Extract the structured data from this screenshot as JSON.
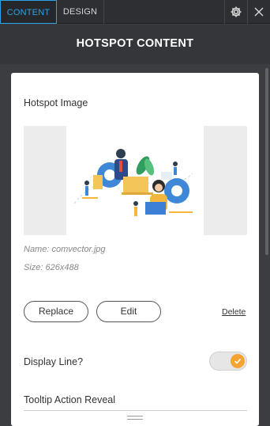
{
  "tabs": [
    {
      "label": "CONTENT",
      "active": true
    },
    {
      "label": "DESIGN",
      "active": false
    }
  ],
  "toolbar_icons": [
    "gear-icon",
    "close-icon"
  ],
  "header": {
    "title": "HOTSPOT CONTENT"
  },
  "image_section": {
    "label": "Hotspot Image",
    "name_line": "Name: comvector.jpg",
    "size_line": "Size: 626x488"
  },
  "buttons": {
    "replace": "Replace",
    "edit": "Edit",
    "delete": "Delete"
  },
  "display_line": {
    "label": "Display Line?",
    "enabled": true
  },
  "tooltip": {
    "label": "Tooltip Action Reveal"
  },
  "colors": {
    "accent": "#2aa3e8",
    "toggle_on": "#f4a531",
    "panel_bg": "#3b3d40"
  }
}
